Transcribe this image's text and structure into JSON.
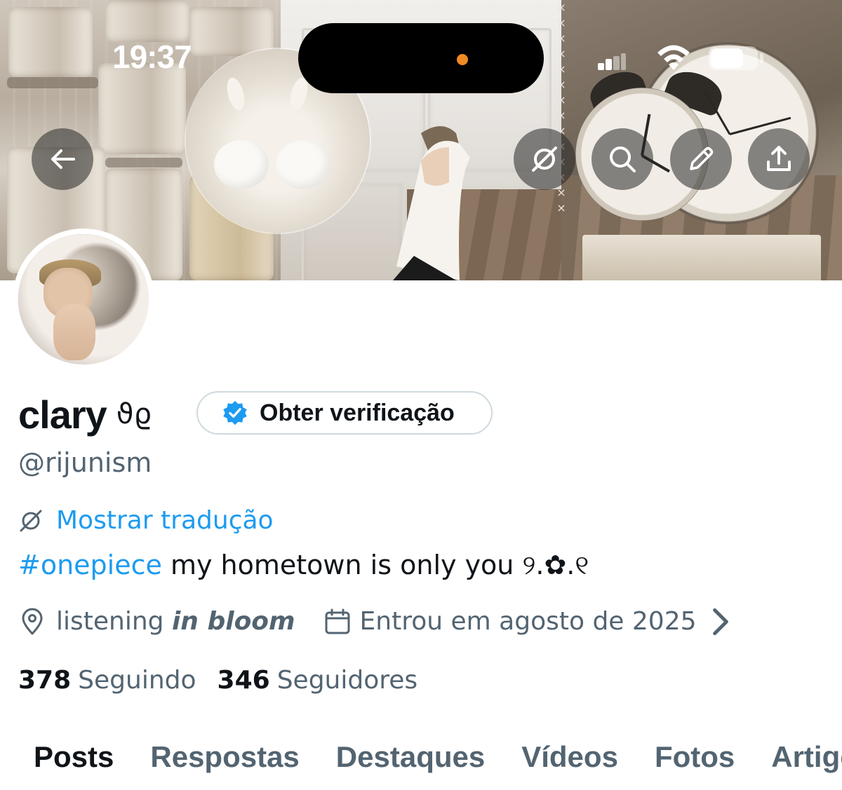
{
  "status_bar": {
    "time": "19:37"
  },
  "profile": {
    "display_name": "clary",
    "name_decoration": "ϑϱ",
    "verify_button": "Obter verificação",
    "handle": "@rijunism",
    "translate_link": "Mostrar tradução",
    "bio": {
      "hashtag": "#onepiece",
      "text": " my hometown is only you ୨.✿.୧"
    },
    "location_prefix": "listening ",
    "location_emphasis": "in bloom",
    "joined": "Entrou em agosto de 2025",
    "following_count": "378",
    "following_label": "Seguindo",
    "followers_count": "346",
    "followers_label": "Seguidores"
  },
  "tabs": [
    {
      "label": "Posts",
      "active": true
    },
    {
      "label": "Respostas",
      "active": false
    },
    {
      "label": "Destaques",
      "active": false
    },
    {
      "label": "Vídeos",
      "active": false
    },
    {
      "label": "Fotos",
      "active": false
    },
    {
      "label": "Artigos",
      "active": false
    }
  ],
  "header_buttons": [
    "back-arrow-icon",
    "translate-icon",
    "search-icon",
    "edit-pencil-icon",
    "share-icon"
  ],
  "colors": {
    "accent": "#1d9bf0",
    "secondary_text": "#536471",
    "primary_text": "#0f1419",
    "island_dot": "#f08a24"
  }
}
